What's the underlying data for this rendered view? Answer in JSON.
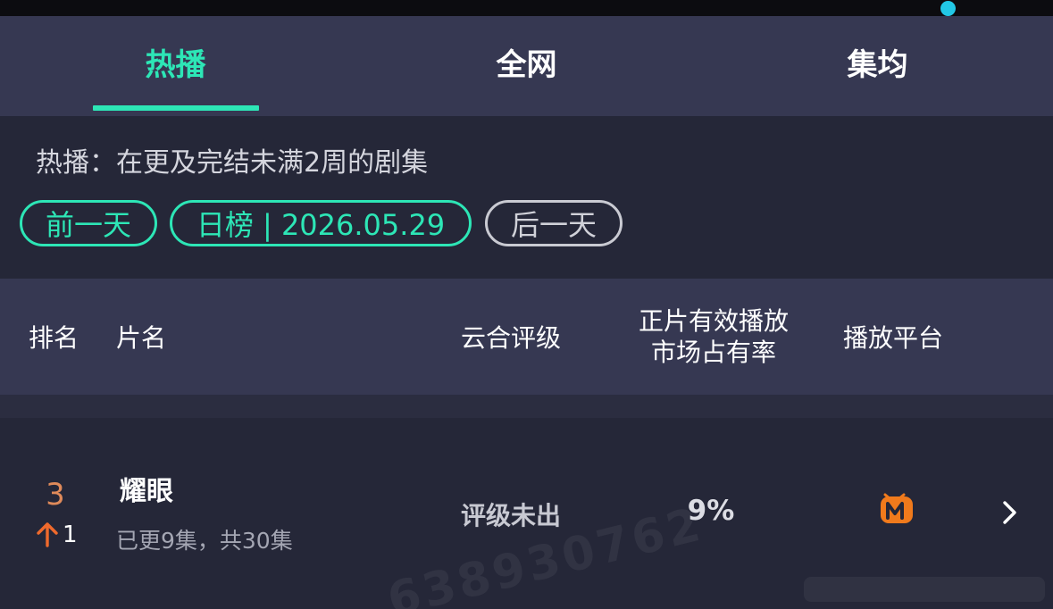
{
  "tabs": [
    {
      "label": "热播",
      "active": true
    },
    {
      "label": "全网",
      "active": false
    },
    {
      "label": "集均",
      "active": false
    }
  ],
  "filter": {
    "note": "热播：在更及完结未满2周的剧集",
    "prev_day": "前一天",
    "date_pill": "日榜 | 2026.05.29",
    "next_day": "后一天"
  },
  "table": {
    "headers": {
      "rank": "排名",
      "title": "片名",
      "rating": "云合评级",
      "share_line1": "正片有效播放",
      "share_line2": "市场占有率",
      "platform": "播放平台"
    },
    "rows": [
      {
        "rank": "3",
        "rank_change": "1",
        "rank_change_direction": "up",
        "title": "耀眼",
        "episodes": "已更9集，共30集",
        "rating": "评级未出",
        "market_share": "9%",
        "platform_icon": "mango-tv-icon"
      }
    ]
  },
  "watermark": "638930762",
  "colors": {
    "accent": "#2de6b6",
    "rank": "#df8a5a",
    "up_arrow": "#f06a2c",
    "platform": "#f07a1c",
    "status_dot": "#22c8e6"
  }
}
